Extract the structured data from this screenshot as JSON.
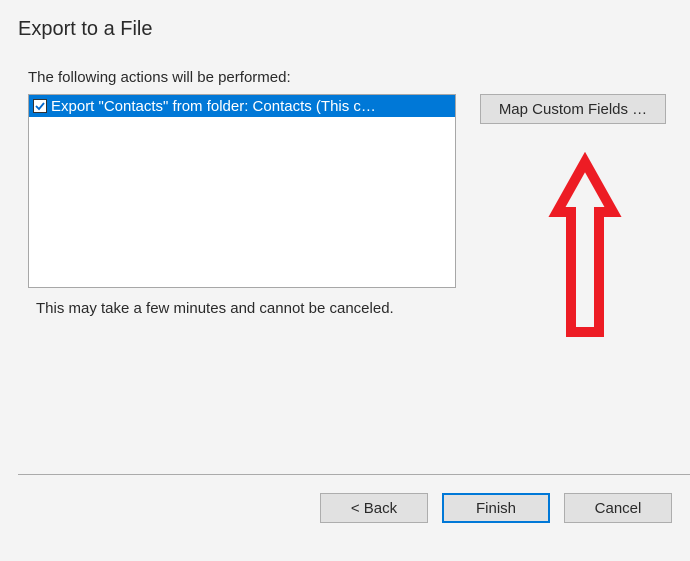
{
  "dialog": {
    "title": "Export to a File",
    "instruction": "The following actions will be performed:",
    "actions": [
      {
        "checked": true,
        "label": "Export \"Contacts\" from folder: Contacts (This c…"
      }
    ],
    "map_button_label": "Map Custom Fields …",
    "note": "This may take a few minutes and cannot be canceled.",
    "buttons": {
      "back": "< Back",
      "finish": "Finish",
      "cancel": "Cancel"
    }
  },
  "annotation": {
    "arrow_color": "#ed1c24"
  }
}
